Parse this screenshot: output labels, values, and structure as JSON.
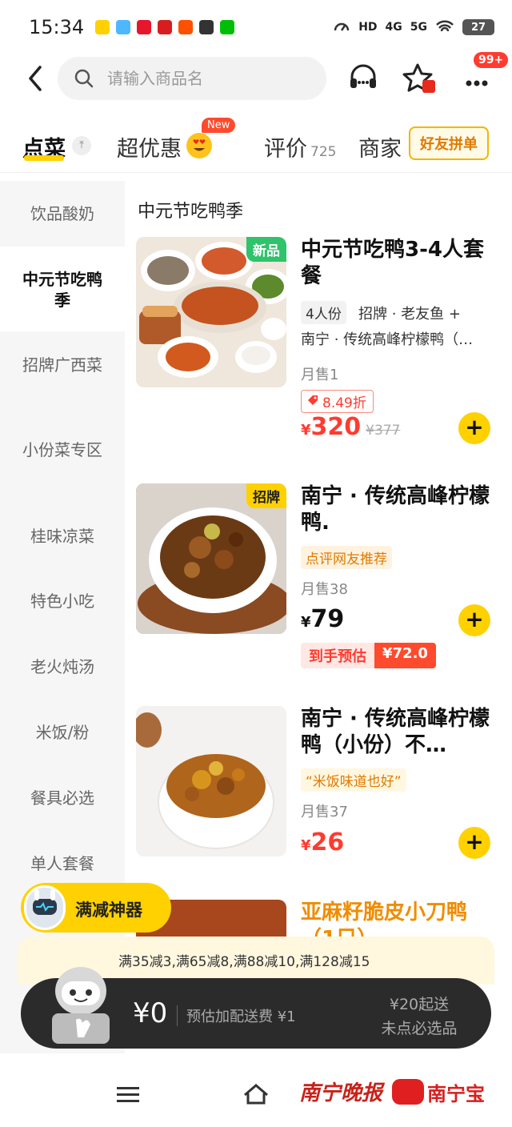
{
  "status_bar": {
    "time": "15:34",
    "hd": "HD",
    "net1": "4G",
    "net2": "5G",
    "battery": "27"
  },
  "header": {
    "search_placeholder": "请输入商品名",
    "notification_badge": "99+"
  },
  "tabs": {
    "order": "点菜",
    "deals": "超优惠",
    "deals_badge": "New",
    "reviews": "评价",
    "review_count": "725",
    "merchant": "商家",
    "friend_order": "好友拼单"
  },
  "sidebar": {
    "items": [
      {
        "label": "饮品酸奶"
      },
      {
        "label": "中元节吃鸭季"
      },
      {
        "label": "招牌广西菜"
      },
      {
        "label": "小份菜专区"
      },
      {
        "label": "桂味凉菜"
      },
      {
        "label": "特色小吃"
      },
      {
        "label": "老火炖汤"
      },
      {
        "label": "米饭/粉"
      },
      {
        "label": "餐具必选"
      },
      {
        "label": "单人套餐"
      }
    ]
  },
  "section_title": "中元节吃鸭季",
  "products": [
    {
      "tag": "新品",
      "name": "中元节吃鸭3-4人套餐",
      "spec_tag": "4人份",
      "spec": "招牌 · 老友鱼 +",
      "desc": "南宁 · 传统高峰柠檬鸭（…",
      "sold": "月售1",
      "discount": "8.49折",
      "yen": "¥",
      "price": "320",
      "old_price": "¥377"
    },
    {
      "tag": "招牌",
      "name": "南宁 · 传统高峰柠檬鸭.",
      "badge": "点评网友推荐",
      "sold": "月售38",
      "yen": "¥",
      "price": "79",
      "estimate_label": "到手预估",
      "estimate_price": "¥72.0"
    },
    {
      "name": "南宁 · 传统高峰柠檬鸭（小份）不…",
      "quote": "“米饭味道也好”",
      "sold": "月售37",
      "yen": "¥",
      "price": "26"
    },
    {
      "name": "亚麻籽脆皮小刀鸭（1只）"
    }
  ],
  "bottom": {
    "promo_label": "满减神器",
    "promo_text": "满35减3,满65减8,满88减10,满128减15",
    "cart_total": "¥0",
    "delivery_fee": "预估加配送费 ¥1",
    "min_order": "¥20起送",
    "missing_required": "未点必选品"
  },
  "watermark": {
    "paper": "南宁晚报",
    "brand": "南宁宝"
  }
}
